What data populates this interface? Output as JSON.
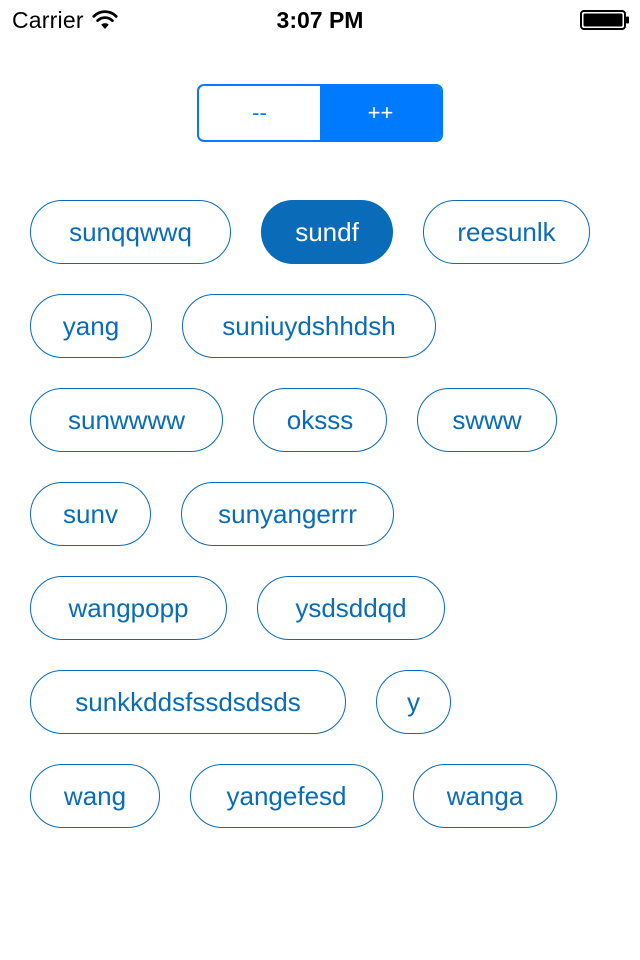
{
  "status_bar": {
    "carrier": "Carrier",
    "time": "3:07 PM",
    "wifi_icon": "wifi-icon",
    "battery_icon": "battery-full-icon"
  },
  "segmented_control": {
    "segments": [
      {
        "label": "--",
        "selected": false
      },
      {
        "label": "++",
        "selected": true
      }
    ]
  },
  "tags": [
    {
      "label": "sunqqwwq",
      "selected": false
    },
    {
      "label": "sundf",
      "selected": true
    },
    {
      "label": "reesunlk",
      "selected": false
    },
    {
      "label": "yang",
      "selected": false
    },
    {
      "label": "suniuydshhdsh",
      "selected": false
    },
    {
      "label": "sunwwww",
      "selected": false
    },
    {
      "label": "oksss",
      "selected": false
    },
    {
      "label": "swww",
      "selected": false
    },
    {
      "label": "sunv",
      "selected": false
    },
    {
      "label": "sunyangerrr",
      "selected": false
    },
    {
      "label": "wangpopp",
      "selected": false
    },
    {
      "label": "ysdsddqd",
      "selected": false
    },
    {
      "label": "sunkkddsfssdsdsds",
      "selected": false
    },
    {
      "label": "y",
      "selected": false
    },
    {
      "label": "wang",
      "selected": false
    },
    {
      "label": "yangefesd",
      "selected": false
    },
    {
      "label": "wanga",
      "selected": false
    }
  ],
  "colors": {
    "accent": "#007aff",
    "tag_color": "#0a6bb8",
    "background": "#ffffff"
  }
}
